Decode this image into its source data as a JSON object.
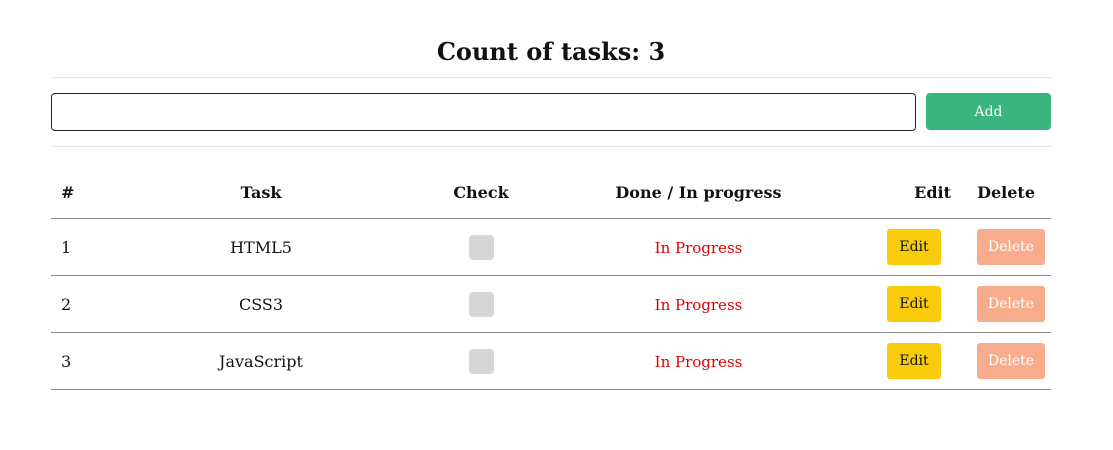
{
  "header": {
    "title": "Count of tasks: 3"
  },
  "form": {
    "input_value": "",
    "input_placeholder": "",
    "add_label": "Add"
  },
  "table": {
    "columns": [
      "#",
      "Task",
      "Check",
      "Done / In progress",
      "Edit",
      "Delete"
    ],
    "rows": [
      {
        "num": "1",
        "task": "HTML5",
        "checked": false,
        "status": "In Progress",
        "edit_label": "Edit",
        "delete_label": "Delete"
      },
      {
        "num": "2",
        "task": "CSS3",
        "checked": false,
        "status": "In Progress",
        "edit_label": "Edit",
        "delete_label": "Delete"
      },
      {
        "num": "3",
        "task": "JavaScript",
        "checked": false,
        "status": "In Progress",
        "edit_label": "Edit",
        "delete_label": "Delete"
      }
    ]
  },
  "colors": {
    "add_button": "#3ab57e",
    "edit_button": "#f9cc0b",
    "delete_button": "#f7ad8b",
    "status_in_progress": "#e00000",
    "checkbox": "#d6d6d6"
  }
}
